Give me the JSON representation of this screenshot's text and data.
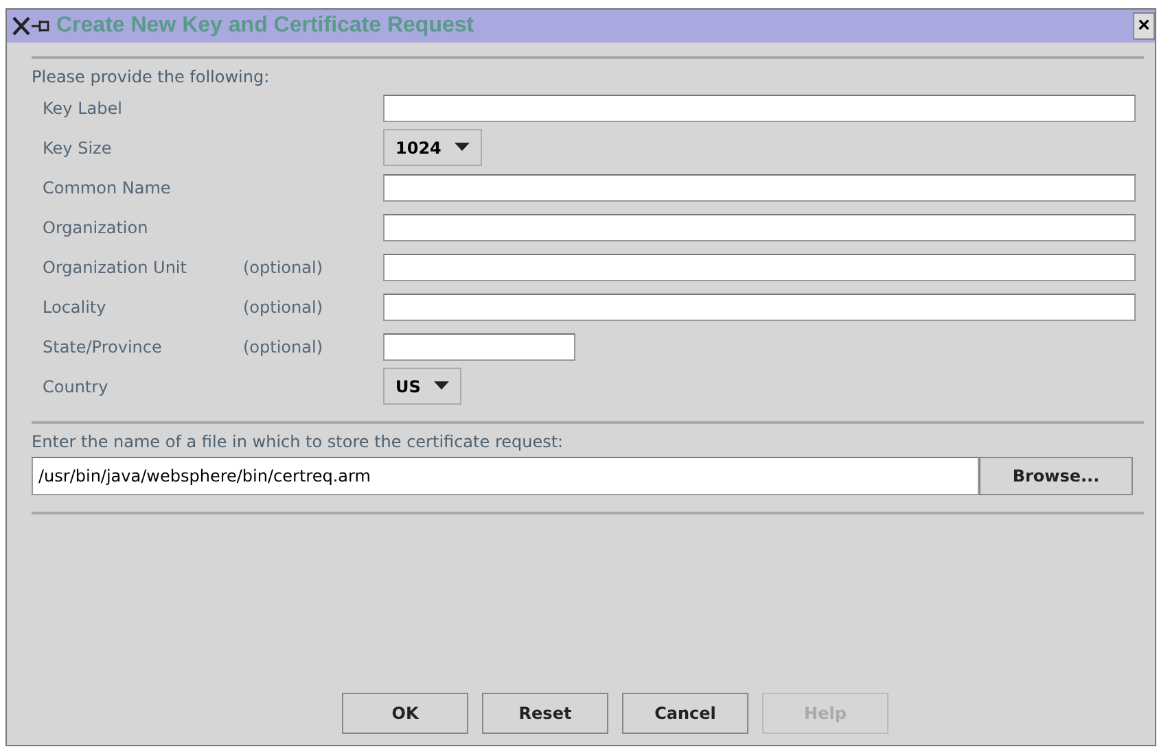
{
  "window": {
    "title": "Create New Key and Certificate Request",
    "close_glyph": "×"
  },
  "intro": "Please provide the following:",
  "fields": [
    {
      "label": "Key Label",
      "kind": "text"
    },
    {
      "label": "Key Size",
      "kind": "dropdown",
      "value": "1024"
    },
    {
      "label": "Common Name",
      "kind": "text"
    },
    {
      "label": "Organization",
      "kind": "text"
    },
    {
      "label": "Organization Unit",
      "note": "(optional)",
      "kind": "text"
    },
    {
      "label": "Locality",
      "note": "(optional)",
      "kind": "text"
    },
    {
      "label": "State/Province",
      "note": "(optional)",
      "kind": "short"
    },
    {
      "label": "Country",
      "kind": "dropdown",
      "value": "US"
    }
  ],
  "file_prompt": "Enter the name of a file in which to store the certificate request:",
  "file_path": "/usr/bin/java/websphere/bin/certreq.arm",
  "browse_button": "Browse...",
  "buttons": [
    {
      "label": "OK",
      "disabled": false
    },
    {
      "label": "Reset",
      "disabled": false
    },
    {
      "label": "Cancel",
      "disabled": false
    },
    {
      "label": "Help",
      "disabled": true
    }
  ]
}
